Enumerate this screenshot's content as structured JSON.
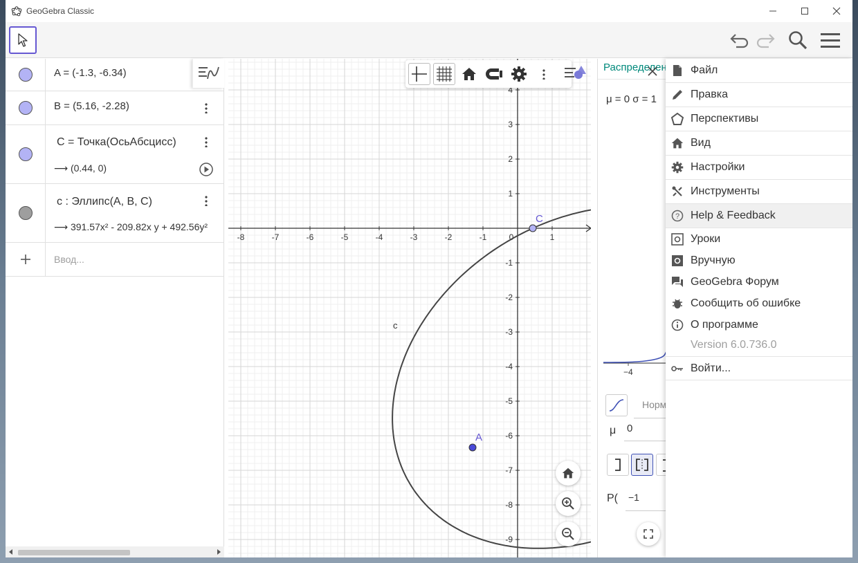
{
  "window": {
    "title": "GeoGebra Classic"
  },
  "toolbar": {
    "active_tool": "move-tool"
  },
  "algebra": {
    "items": [
      {
        "name": "A",
        "text": "A = (-1.3, -6.34)",
        "color": "#b3b3f5"
      },
      {
        "name": "B",
        "text": "B = (5.16, -2.28)",
        "color": "#b3b3f5"
      },
      {
        "name": "C",
        "text": "C = Точка(ОсьАбсцисс)",
        "result": "⟶ (0.44, 0)",
        "color": "#b3b3f5"
      },
      {
        "name": "c",
        "text": "c : Эллипс(A, B, C)",
        "result": "⟶ 391.57x² - 209.82x y + 492.56y²",
        "color": "#9e9e9e"
      }
    ],
    "input_placeholder": "Ввод..."
  },
  "graphics": {
    "x_ticks": [
      "-8",
      "-7",
      "-6",
      "-5",
      "-4",
      "-3",
      "-2",
      "-1",
      "0",
      "1"
    ],
    "y_ticks": [
      "4",
      "3",
      "2",
      "1",
      "-1",
      "-2",
      "-3",
      "-4",
      "-5",
      "-6",
      "-7",
      "-8",
      "-9"
    ],
    "point_labels": {
      "A": "A",
      "C": "C",
      "curve": "c"
    },
    "accent": "#6557d2"
  },
  "probability": {
    "title": "Распределение",
    "params": "μ = 0 σ = 1",
    "axis_tick": "−4",
    "dist_name": "Норм",
    "mu_label": "μ",
    "mu_value": "0",
    "p_label": "P(",
    "p_value": "−1",
    "title_color": "#00897b"
  },
  "menu": {
    "items": [
      {
        "label": "Файл",
        "icon": "file-icon"
      },
      {
        "label": "Правка",
        "icon": "pencil-icon"
      },
      {
        "label": "Перспективы",
        "icon": "perspectives-icon"
      },
      {
        "label": "Вид",
        "icon": "home-icon"
      },
      {
        "label": "Настройки",
        "icon": "gear-icon"
      },
      {
        "label": "Инструменты",
        "icon": "tools-icon"
      },
      {
        "label": "Help & Feedback",
        "icon": "help-icon"
      }
    ],
    "sub_items": [
      {
        "label": "Уроки",
        "icon": "tutorials-icon"
      },
      {
        "label": "Вручную",
        "icon": "manual-icon"
      },
      {
        "label": "GeoGebra Форум",
        "icon": "forum-icon"
      },
      {
        "label": "Сообщить об ошибке",
        "icon": "bug-icon"
      },
      {
        "label": "О программе",
        "icon": "info-icon"
      }
    ],
    "version": "Version 6.0.736.0",
    "sign_in": "Войти..."
  }
}
